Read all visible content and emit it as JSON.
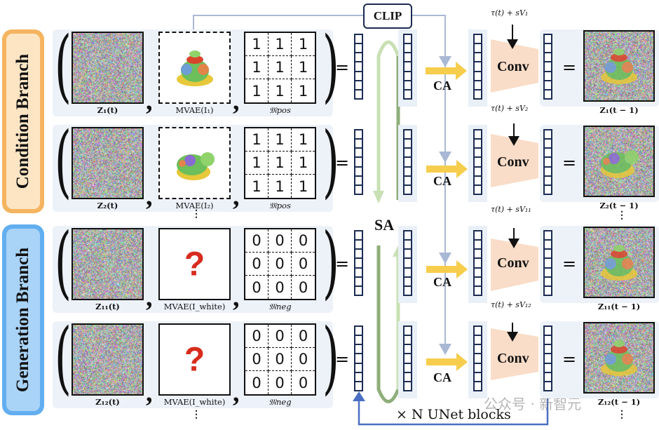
{
  "branches": {
    "condition": {
      "label": "Condition Branch",
      "border_color": "#f5b460",
      "fill_color": "#fde5c4"
    },
    "generation": {
      "label": "Generation Branch",
      "border_color": "#63aef0",
      "fill_color": "#a9d3f7"
    }
  },
  "clip_label": "CLIP",
  "sa_label": "SA",
  "ca_label": "CA",
  "conv_label": "Conv",
  "equals": "=",
  "comma": ",",
  "ellipsis": "⋮",
  "loop_label": "× N UNet blocks",
  "watermark": "公众号 · 新智元",
  "rows": [
    {
      "latent_label": "Z₁(t)",
      "cond_label": "MVAE(I₁)",
      "cond_type": "image",
      "mask_label": "𝔐pos",
      "mask_values": [
        "1",
        "1",
        "1",
        "1",
        "1",
        "1",
        "1",
        "1",
        "1"
      ],
      "tau_label": "τ(t) + sV₁",
      "output_label": "Z₁(t − 1)"
    },
    {
      "latent_label": "Z₂(t)",
      "cond_label": "MVAE(I₂)",
      "cond_type": "image",
      "mask_label": "𝔐pos",
      "mask_values": [
        "1",
        "1",
        "1",
        "1",
        "1",
        "1",
        "1",
        "1",
        "1"
      ],
      "tau_label": "τ(t) + sV₂",
      "output_label": "Z₂(t − 1)"
    },
    {
      "latent_label": "Z₁₁(t)",
      "cond_label": "MVAE(I_white)",
      "cond_type": "unknown",
      "question_mark": "?",
      "mask_label": "𝔐neg",
      "mask_values": [
        "0",
        "0",
        "0",
        "0",
        "0",
        "0",
        "0",
        "0",
        "0"
      ],
      "tau_label": "τ(t) + sV₁₁",
      "output_label": "Z₁₁(t − 1)"
    },
    {
      "latent_label": "Z₁₂(t)",
      "cond_label": "MVAE(I_white)",
      "cond_type": "unknown",
      "question_mark": "?",
      "mask_label": "𝔐neg",
      "mask_values": [
        "0",
        "0",
        "0",
        "0",
        "0",
        "0",
        "0",
        "0",
        "0"
      ],
      "tau_label": "τ(t) + sV₁₂",
      "output_label": "Z₁₂(t − 1)"
    }
  ],
  "colors": {
    "ca_arrow": "#f6cd4c",
    "clip_line": "#a9b8d4",
    "loop_arrow": "#4a6fc2",
    "conv_fill": "#f9ddc8",
    "sa_arrow_light": "#c9e0b4",
    "sa_arrow_dark": "#8fae7a",
    "question": "#d72b1e"
  }
}
